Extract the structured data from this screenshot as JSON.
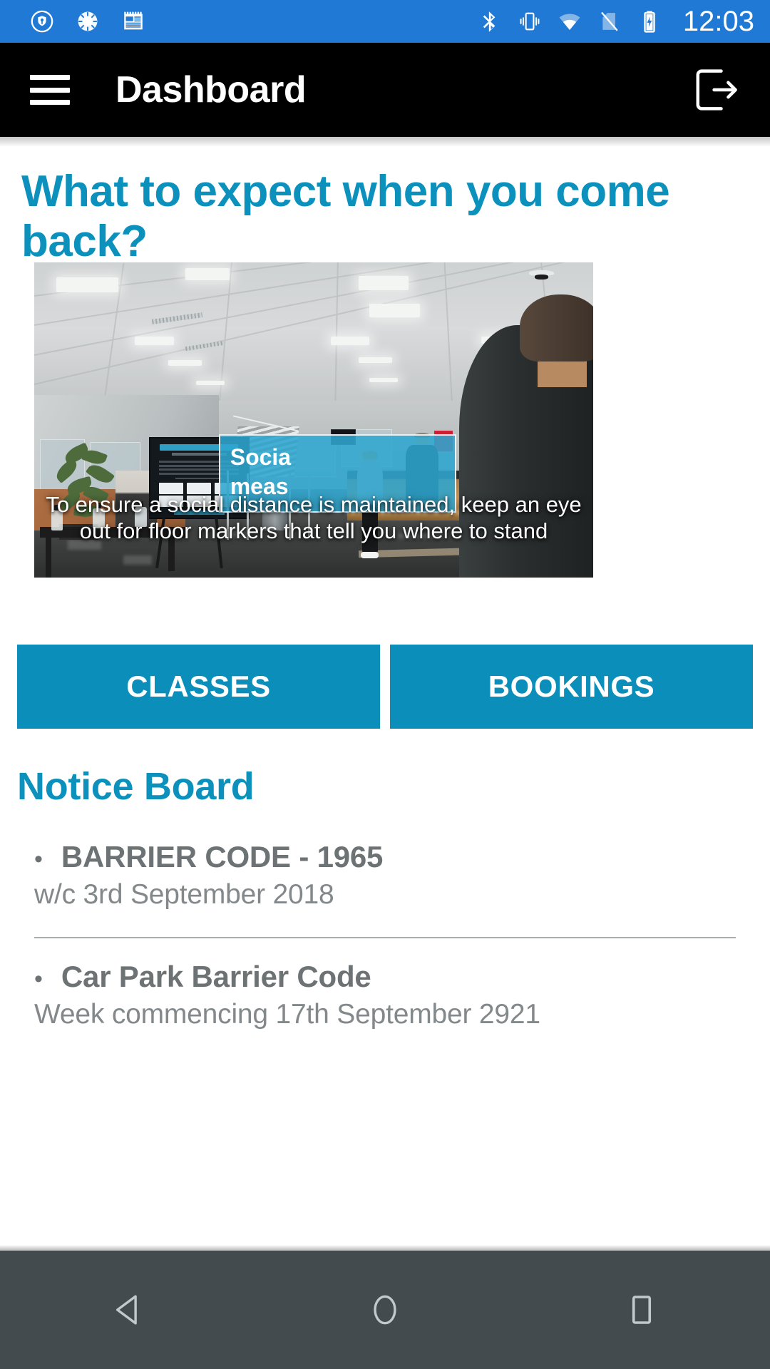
{
  "status_bar": {
    "time": "12:03",
    "background": "#2079d4",
    "notification_icons": [
      {
        "name": "vpn-key-shield-icon"
      },
      {
        "name": "loading-spinner-icon"
      },
      {
        "name": "news-article-icon"
      }
    ],
    "system_icons": [
      {
        "name": "bluetooth-icon"
      },
      {
        "name": "vibrate-mode-icon"
      },
      {
        "name": "wifi-icon"
      },
      {
        "name": "no-sim-card-icon"
      },
      {
        "name": "battery-charging-icon"
      }
    ]
  },
  "app_bar": {
    "title": "Dashboard",
    "menu_icon": "hamburger-menu-icon",
    "logout_icon": "logout-icon",
    "background": "#000000"
  },
  "main": {
    "heading": "What to expect when you come back?",
    "heading_color": "#0c91bd",
    "video": {
      "overlay_line1": "Socia",
      "overlay_line2": "meas",
      "overlay_color": "#2fa6cf",
      "caption": "To ensure a social distance is maintained, keep an eye out for floor markers that tell you where to stand"
    },
    "buttons": [
      {
        "label": "CLASSES",
        "name": "classes-button"
      },
      {
        "label": "BOOKINGS",
        "name": "bookings-button"
      }
    ],
    "button_color": "#0b8fba",
    "notice_board": {
      "heading": "Notice Board",
      "items": [
        {
          "bullet": "•",
          "title": "BARRIER CODE - 1965",
          "body": "w/c 3rd September 2018"
        },
        {
          "bullet": "•",
          "title": "Car Park Barrier Code",
          "body": "Week commencing 17th September 2921"
        }
      ]
    }
  },
  "nav_bar": {
    "background": "#434b4e",
    "buttons": [
      {
        "name": "nav-back-button",
        "icon": "back-triangle-icon"
      },
      {
        "name": "nav-home-button",
        "icon": "home-circle-icon"
      },
      {
        "name": "nav-recents-button",
        "icon": "recents-square-icon"
      }
    ]
  }
}
